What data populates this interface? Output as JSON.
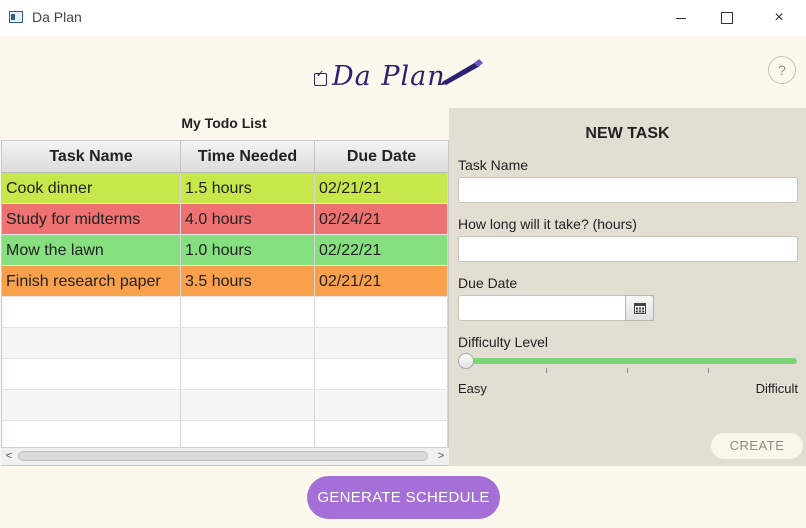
{
  "window": {
    "title": "Da Plan",
    "min_icon": "minimize-icon",
    "max_icon": "maximize-icon",
    "close_icon": "×"
  },
  "header": {
    "logo_text": "Da Plan",
    "help_label": "?",
    "logo_color": "#2a2270"
  },
  "todo": {
    "title": "My Todo List",
    "columns": [
      "Task Name",
      "Time Needed",
      "Due Date"
    ],
    "rows": [
      {
        "name": "Cook dinner",
        "time": "1.5 hours",
        "due": "02/21/21",
        "color": "#c6e84a"
      },
      {
        "name": "Study for midterms",
        "time": "4.0 hours",
        "due": "02/24/21",
        "color": "#ef7272"
      },
      {
        "name": "Mow the lawn",
        "time": "1.0 hours",
        "due": "02/22/21",
        "color": "#86e07f"
      },
      {
        "name": "Finish research paper",
        "time": "3.5 hours",
        "due": "02/21/21",
        "color": "#f9a04c"
      }
    ],
    "empty_rows": 5
  },
  "new_task": {
    "heading": "NEW TASK",
    "task_name_label": "Task Name",
    "task_name_value": "",
    "duration_label": "How long will it take? (hours)",
    "duration_value": "",
    "due_date_label": "Due Date",
    "due_date_value": "",
    "calendar_icon": "calendar-icon",
    "difficulty_label": "Difficulty Level",
    "difficulty_level": 0,
    "easy_label": "Easy",
    "difficult_label": "Difficult",
    "create_label": "CREATE"
  },
  "footer": {
    "generate_label": "GENERATE SCHEDULE",
    "accent": "#a56fd8"
  }
}
